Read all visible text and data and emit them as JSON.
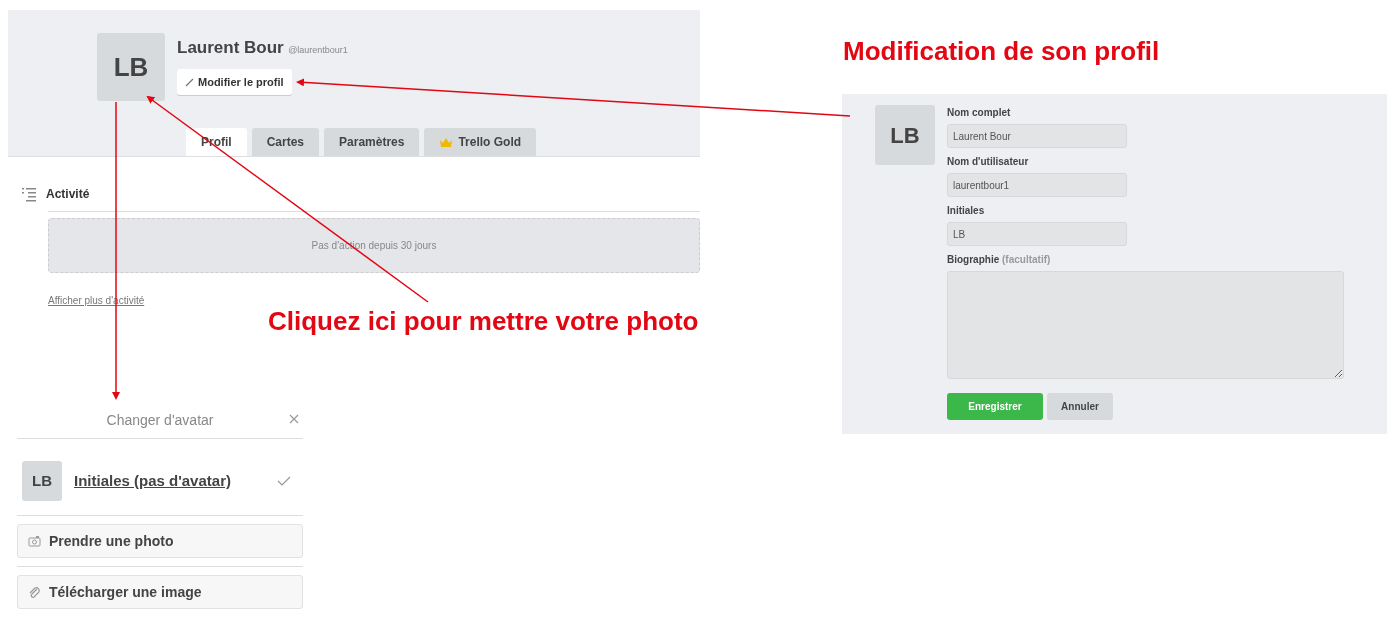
{
  "profile_page": {
    "avatar_initials": "LB",
    "name": "Laurent Bour",
    "username": "@laurentbour1",
    "edit_button": "Modifier le profil",
    "tabs": [
      {
        "label": "Profil",
        "selected": true,
        "kind": "plain"
      },
      {
        "label": "Cartes",
        "selected": false,
        "kind": "plain"
      },
      {
        "label": "Paramètres",
        "selected": false,
        "kind": "plain"
      },
      {
        "label": "Trello Gold",
        "selected": false,
        "kind": "gold"
      }
    ],
    "activity": {
      "title": "Activité",
      "empty_message": "Pas d'action depuis 30 jours",
      "more_link": "Afficher plus d'activité"
    }
  },
  "annotations": [
    "Modification de son profil",
    "Cliquez ici pour mettre votre photo"
  ],
  "edit_form": {
    "avatar_initials": "LB",
    "fields": [
      {
        "label": "Nom complet",
        "value": "Laurent Bour",
        "kind": "input"
      },
      {
        "label": "Nom d'utilisateur",
        "value": "laurentbour1",
        "kind": "input"
      },
      {
        "label": "Initiales",
        "value": "LB",
        "kind": "input"
      },
      {
        "label": "Biographie",
        "hint": "(facultatif)",
        "kind": "textarea"
      }
    ],
    "buttons": [
      {
        "label": "Enregistrer",
        "kind": "primary"
      },
      {
        "label": "Annuler",
        "kind": "secondary"
      }
    ]
  },
  "avatar_popover": {
    "title": "Changer d'avatar",
    "options": [
      {
        "label": "Initiales (pas d'avatar)",
        "avatar_initials": "LB",
        "selected": true
      }
    ],
    "actions": [
      {
        "label": "Prendre une photo",
        "kind": "camera"
      },
      {
        "label": "Télécharger une image",
        "kind": "attachment"
      }
    ]
  }
}
